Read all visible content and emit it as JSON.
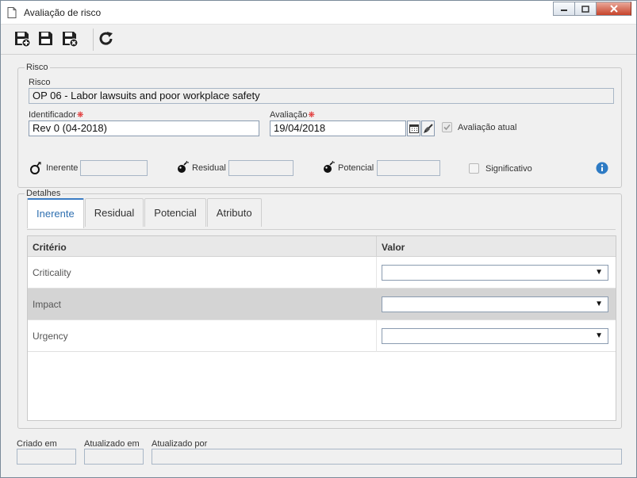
{
  "window": {
    "title": "Avaliação de risco"
  },
  "icons": {
    "title": "document-icon",
    "save_new": "save-new-icon",
    "save": "save-icon",
    "save_close": "save-close-icon",
    "refresh": "refresh-icon",
    "info": "info-icon",
    "calendar": "calendar-icon",
    "clear": "brush-icon"
  },
  "risco": {
    "legend": "Risco",
    "risco_label": "Risco",
    "risco_value": "OP 06 - Labor lawsuits and poor workplace safety",
    "identificador_label": "Identificador",
    "identificador_value": "Rev 0 (04-2018)",
    "avaliacao_label": "Avaliação",
    "avaliacao_value": "19/04/2018",
    "avaliacao_atual_label": "Avaliação atual",
    "inerente_label": "Inerente",
    "residual_label": "Residual",
    "potencial_label": "Potencial",
    "significativo_label": "Significativo"
  },
  "detalhes": {
    "legend": "Detalhes",
    "tabs": [
      "Inerente",
      "Residual",
      "Potencial",
      "Atributo"
    ],
    "active_tab": "Inerente",
    "columns": {
      "criterio": "Critério",
      "valor": "Valor"
    },
    "rows": [
      {
        "name": "Criticality",
        "value": ""
      },
      {
        "name": "Impact",
        "value": ""
      },
      {
        "name": "Urgency",
        "value": ""
      }
    ]
  },
  "footer": {
    "criado_em": "Criado em",
    "atualizado_em": "Atualizado em",
    "atualizado_por": "Atualizado por"
  },
  "colors": {
    "accent": "#2e6fb0",
    "required": "#e02020",
    "selected_row": "#d4d4d4"
  }
}
